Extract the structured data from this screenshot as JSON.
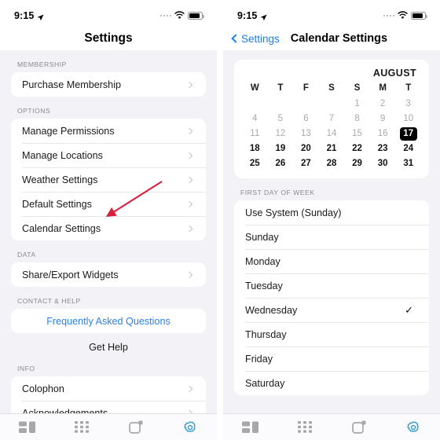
{
  "status_bar": {
    "time": "9:15",
    "location_icon": "location-arrow-icon",
    "signal_icon": "signal-dots-icon",
    "wifi_icon": "wifi-icon",
    "battery_icon": "battery-icon"
  },
  "left_screen": {
    "nav": {
      "title": "Settings"
    },
    "sections": [
      {
        "header": "MEMBERSHIP",
        "style": "card",
        "rows": [
          {
            "label": "Purchase Membership",
            "accessory": "chevron"
          }
        ]
      },
      {
        "header": "OPTIONS",
        "style": "card",
        "rows": [
          {
            "label": "Manage Permissions",
            "accessory": "chevron"
          },
          {
            "label": "Manage Locations",
            "accessory": "chevron"
          },
          {
            "label": "Weather Settings",
            "accessory": "chevron"
          },
          {
            "label": "Default Settings",
            "accessory": "chevron"
          },
          {
            "label": "Calendar Settings",
            "accessory": "chevron"
          }
        ]
      },
      {
        "header": "DATA",
        "style": "card",
        "rows": [
          {
            "label": "Share/Export Widgets",
            "accessory": "chevron"
          }
        ]
      },
      {
        "header": "CONTACT & HELP",
        "style": "card",
        "rows": [
          {
            "label": "Frequently Asked Questions",
            "accessory": "none",
            "align": "center",
            "color": "blue"
          }
        ]
      },
      {
        "header": "",
        "style": "plain",
        "rows": [
          {
            "label": "Get Help",
            "accessory": "none",
            "align": "center"
          }
        ]
      },
      {
        "header": "INFO",
        "style": "card",
        "rows": [
          {
            "label": "Colophon",
            "accessory": "chevron"
          },
          {
            "label": "Acknowledgements",
            "accessory": "chevron"
          }
        ]
      }
    ],
    "annotation": {
      "type": "arrow",
      "color": "#d81f3c",
      "points_to": "Calendar Settings"
    }
  },
  "right_screen": {
    "nav": {
      "back_label": "Settings",
      "title": "Calendar Settings"
    },
    "calendar": {
      "month": "AUGUST",
      "weekday_headers": [
        "W",
        "T",
        "F",
        "S",
        "S",
        "M",
        "T"
      ],
      "leading_blanks": 4,
      "days": [
        1,
        2,
        3,
        4,
        5,
        6,
        7,
        8,
        9,
        10,
        11,
        12,
        13,
        14,
        15,
        16,
        17,
        18,
        19,
        20,
        21,
        22,
        23,
        24,
        25,
        26,
        27,
        28,
        29,
        30,
        31
      ],
      "today": 17,
      "past_days_through": 16
    },
    "first_day_of_week": {
      "header": "FIRST DAY OF WEEK",
      "selected": "Wednesday",
      "check_glyph": "✓",
      "options": [
        {
          "label": "Use System (Sunday)"
        },
        {
          "label": "Sunday"
        },
        {
          "label": "Monday"
        },
        {
          "label": "Tuesday"
        },
        {
          "label": "Wednesday"
        },
        {
          "label": "Thursday"
        },
        {
          "label": "Friday"
        },
        {
          "label": "Saturday"
        }
      ]
    }
  },
  "tab_bar": {
    "active_color": "#2f9ad0",
    "inactive_color": "#a6a6ab",
    "tabs": [
      {
        "name": "widgets-tab",
        "icon": "widget-layout-icon",
        "active": false
      },
      {
        "name": "grid-tab",
        "icon": "grid-dots-icon",
        "active": false
      },
      {
        "name": "card-tab",
        "icon": "rounded-square-badge-icon",
        "active": false
      },
      {
        "name": "settings-tab",
        "icon": "gear-icon",
        "active": true
      }
    ]
  }
}
